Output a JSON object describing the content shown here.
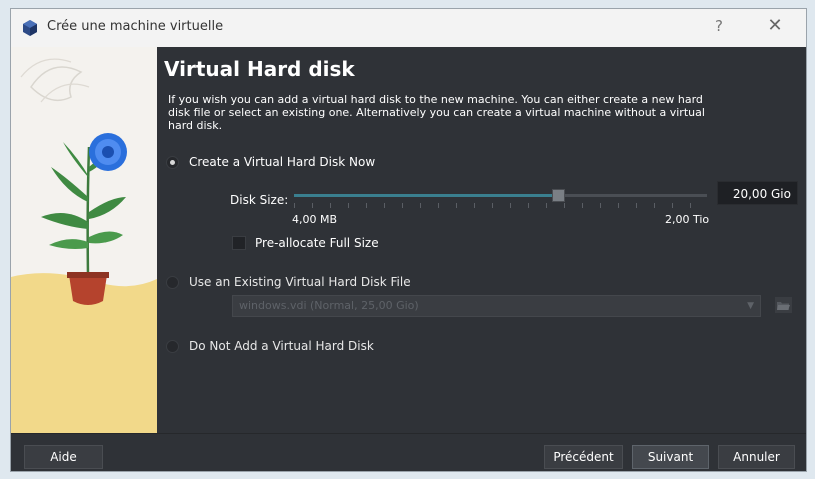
{
  "window": {
    "title": "Crée une machine virtuelle",
    "help_label": "?",
    "close_label": "✕"
  },
  "page": {
    "heading": "Virtual Hard disk",
    "description": "If you wish you can add a virtual hard disk to the new machine. You can either create a new hard disk file or select an existing one. Alternatively you can create a virtual machine without a virtual hard disk."
  },
  "options": {
    "create_now": {
      "label": "Create a Virtual Hard Disk Now",
      "selected": true
    },
    "use_existing": {
      "label": "Use an Existing Virtual Hard Disk File",
      "selected": false
    },
    "no_disk": {
      "label": "Do Not Add a Virtual Hard Disk",
      "selected": false
    }
  },
  "disk": {
    "size_label": "Disk Size:",
    "size_value": "20,00 Gio",
    "slider_fraction": 0.64,
    "min_label": "4,00 MB",
    "max_label": "2,00 Tio",
    "preallocate_label": "Pre-allocate Full Size",
    "preallocate_checked": false
  },
  "existing": {
    "selected_file": "windows.vdi (Normal, 25,00 Gio)",
    "folder_icon": "folder-open-icon"
  },
  "footer": {
    "help_button": "Aide",
    "back_button": "Précédent",
    "next_button": "Suivant",
    "cancel_button": "Annuler"
  },
  "colors": {
    "dialog_bg": "#2f3237",
    "accent_slider": "#3a7f8f",
    "titlebar_bg": "#f3f3f3"
  }
}
